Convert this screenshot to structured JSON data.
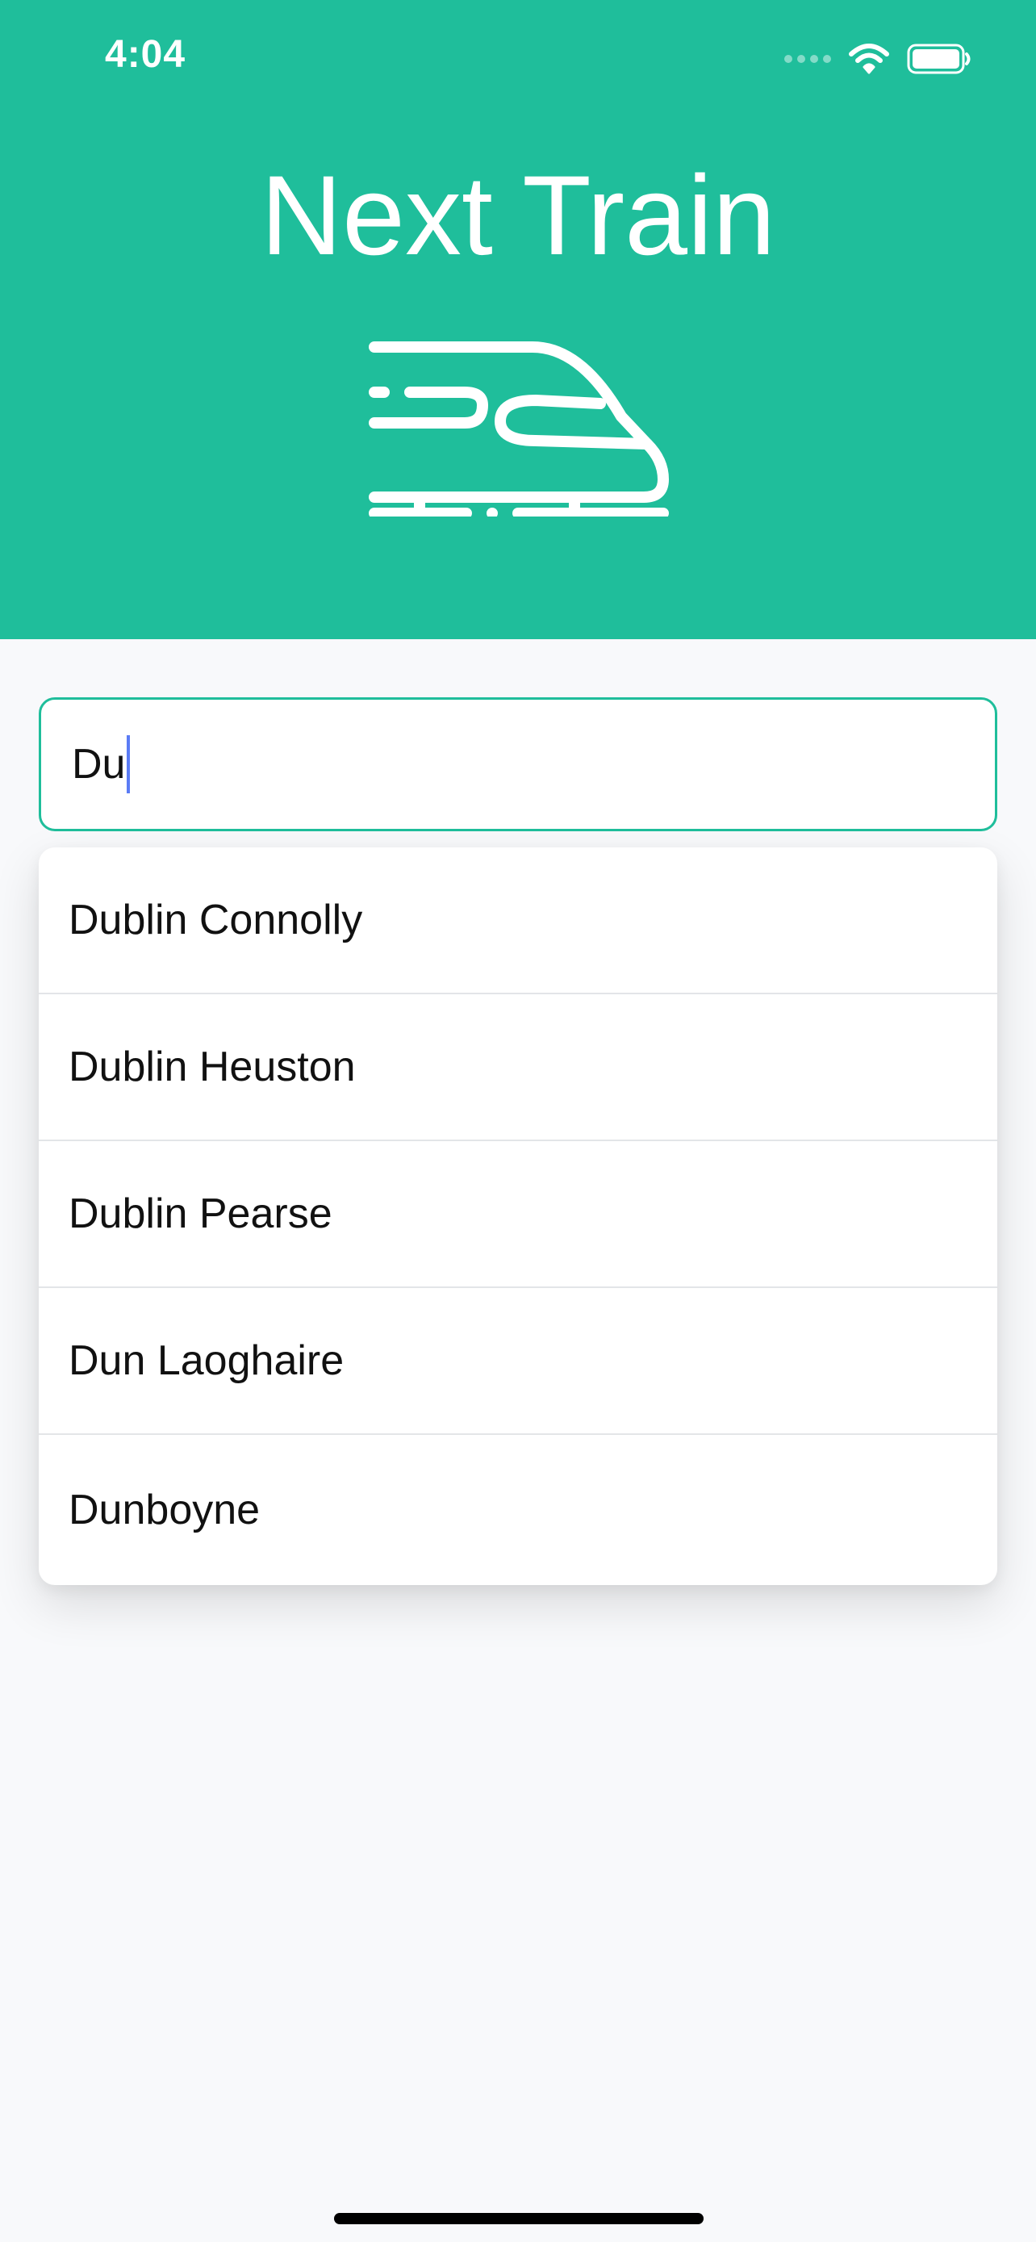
{
  "status_bar": {
    "time": "4:04",
    "icons": [
      "cellular-signal-icon",
      "wifi-icon",
      "battery-icon"
    ]
  },
  "header": {
    "title": "Next Train",
    "icon": "train-icon",
    "background_color": "#1fbe9b"
  },
  "search": {
    "value": "Du",
    "border_color": "#1fbe9b",
    "caret_color": "#5b7cf5"
  },
  "suggestions": {
    "items": [
      {
        "label": "Dublin Connolly"
      },
      {
        "label": "Dublin Heuston"
      },
      {
        "label": "Dublin Pearse"
      },
      {
        "label": "Dun Laoghaire"
      },
      {
        "label": "Dunboyne"
      }
    ]
  }
}
